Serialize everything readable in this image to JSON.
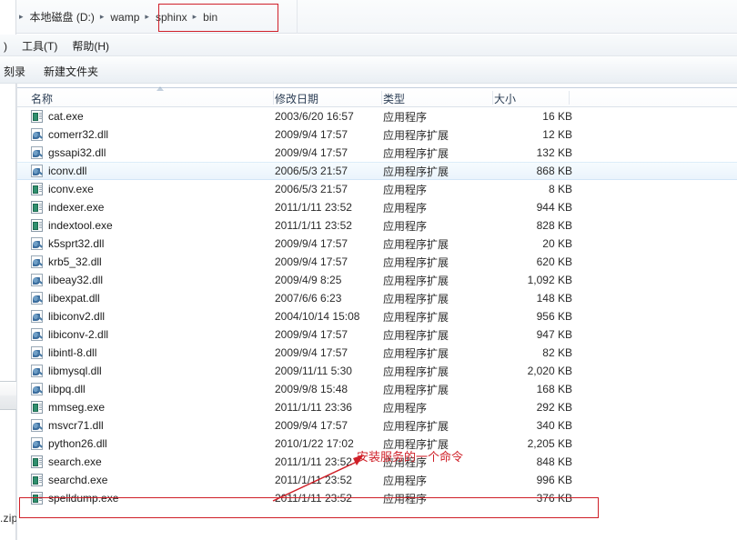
{
  "window": {
    "accent_red": "#cf1f27",
    "hover_blue": "#eaf4fc"
  },
  "background": {
    "partial_zip_label": ".zip"
  },
  "addressbar": {
    "separator_icon": "chevron-right-icon",
    "crumbs": [
      {
        "label": "本地磁盘 (D:)",
        "highlighted": false
      },
      {
        "label": "wamp",
        "highlighted": false
      },
      {
        "label": "sphinx",
        "highlighted": true
      },
      {
        "label": "bin",
        "highlighted": true
      }
    ]
  },
  "menubar": {
    "items": [
      {
        "label": ")"
      },
      {
        "label": "工具(T)"
      },
      {
        "label": "帮助(H)"
      }
    ]
  },
  "toolbar": {
    "items": [
      {
        "label": "刻录"
      },
      {
        "label": "新建文件夹"
      }
    ]
  },
  "filelist": {
    "sort_icon": "sort-ascending-icon",
    "columns": [
      {
        "key": "name",
        "label": "名称"
      },
      {
        "key": "date",
        "label": "修改日期"
      },
      {
        "key": "type",
        "label": "类型"
      },
      {
        "key": "size",
        "label": "大小"
      }
    ],
    "types": {
      "exe": "应用程序",
      "dll": "应用程序扩展"
    },
    "rows": [
      {
        "name": "cat.exe",
        "icon": "exe-file-icon",
        "kind": "exe",
        "date": "2003/6/20 16:57",
        "type": "应用程序",
        "size": "16 KB",
        "state": "normal"
      },
      {
        "name": "comerr32.dll",
        "icon": "dll-file-icon",
        "kind": "dll",
        "date": "2009/9/4 17:57",
        "type": "应用程序扩展",
        "size": "12 KB",
        "state": "normal"
      },
      {
        "name": "gssapi32.dll",
        "icon": "dll-file-icon",
        "kind": "dll",
        "date": "2009/9/4 17:57",
        "type": "应用程序扩展",
        "size": "132 KB",
        "state": "normal"
      },
      {
        "name": "iconv.dll",
        "icon": "dll-file-icon",
        "kind": "dll",
        "date": "2006/5/3 21:57",
        "type": "应用程序扩展",
        "size": "868 KB",
        "state": "hover"
      },
      {
        "name": "iconv.exe",
        "icon": "exe-file-icon",
        "kind": "exe",
        "date": "2006/5/3 21:57",
        "type": "应用程序",
        "size": "8 KB",
        "state": "normal"
      },
      {
        "name": "indexer.exe",
        "icon": "exe-file-icon",
        "kind": "exe",
        "date": "2011/1/11 23:52",
        "type": "应用程序",
        "size": "944 KB",
        "state": "normal"
      },
      {
        "name": "indextool.exe",
        "icon": "exe-file-icon",
        "kind": "exe",
        "date": "2011/1/11 23:52",
        "type": "应用程序",
        "size": "828 KB",
        "state": "normal"
      },
      {
        "name": "k5sprt32.dll",
        "icon": "dll-file-icon",
        "kind": "dll",
        "date": "2009/9/4 17:57",
        "type": "应用程序扩展",
        "size": "20 KB",
        "state": "normal"
      },
      {
        "name": "krb5_32.dll",
        "icon": "dll-file-icon",
        "kind": "dll",
        "date": "2009/9/4 17:57",
        "type": "应用程序扩展",
        "size": "620 KB",
        "state": "normal"
      },
      {
        "name": "libeay32.dll",
        "icon": "dll-file-icon",
        "kind": "dll",
        "date": "2009/4/9 8:25",
        "type": "应用程序扩展",
        "size": "1,092 KB",
        "state": "normal"
      },
      {
        "name": "libexpat.dll",
        "icon": "dll-file-icon",
        "kind": "dll",
        "date": "2007/6/6 6:23",
        "type": "应用程序扩展",
        "size": "148 KB",
        "state": "normal"
      },
      {
        "name": "libiconv2.dll",
        "icon": "dll-file-icon",
        "kind": "dll",
        "date": "2004/10/14 15:08",
        "type": "应用程序扩展",
        "size": "956 KB",
        "state": "normal"
      },
      {
        "name": "libiconv-2.dll",
        "icon": "dll-file-icon",
        "kind": "dll",
        "date": "2009/9/4 17:57",
        "type": "应用程序扩展",
        "size": "947 KB",
        "state": "normal"
      },
      {
        "name": "libintl-8.dll",
        "icon": "dll-file-icon",
        "kind": "dll",
        "date": "2009/9/4 17:57",
        "type": "应用程序扩展",
        "size": "82 KB",
        "state": "normal"
      },
      {
        "name": "libmysql.dll",
        "icon": "dll-file-icon",
        "kind": "dll",
        "date": "2009/11/11 5:30",
        "type": "应用程序扩展",
        "size": "2,020 KB",
        "state": "normal"
      },
      {
        "name": "libpq.dll",
        "icon": "dll-file-icon",
        "kind": "dll",
        "date": "2009/9/8 15:48",
        "type": "应用程序扩展",
        "size": "168 KB",
        "state": "normal"
      },
      {
        "name": "mmseg.exe",
        "icon": "exe-file-icon",
        "kind": "exe",
        "date": "2011/1/11 23:36",
        "type": "应用程序",
        "size": "292 KB",
        "state": "normal"
      },
      {
        "name": "msvcr71.dll",
        "icon": "dll-file-icon",
        "kind": "dll",
        "date": "2009/9/4 17:57",
        "type": "应用程序扩展",
        "size": "340 KB",
        "state": "normal"
      },
      {
        "name": "python26.dll",
        "icon": "dll-file-icon",
        "kind": "dll",
        "date": "2010/1/22 17:02",
        "type": "应用程序扩展",
        "size": "2,205 KB",
        "state": "normal"
      },
      {
        "name": "search.exe",
        "icon": "exe-file-icon",
        "kind": "exe",
        "date": "2011/1/11 23:52",
        "type": "应用程序",
        "size": "848 KB",
        "state": "normal"
      },
      {
        "name": "searchd.exe",
        "icon": "exe-file-icon",
        "kind": "exe",
        "date": "2011/1/11 23:52",
        "type": "应用程序",
        "size": "996 KB",
        "state": "boxed"
      },
      {
        "name": "spelldump.exe",
        "icon": "exe-file-icon",
        "kind": "exe",
        "date": "2011/1/11 23:52",
        "type": "应用程序",
        "size": "376 KB",
        "state": "normal"
      }
    ]
  },
  "annotation": {
    "text": "安装服务的一个命令",
    "arrow_icon": "red-arrow-icon",
    "target_row": "searchd.exe"
  }
}
